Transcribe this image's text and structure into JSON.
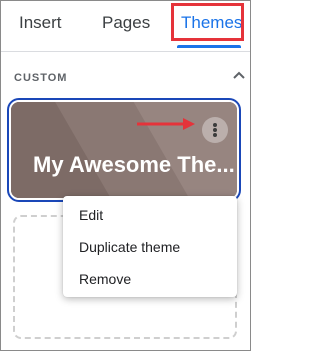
{
  "tabs": [
    {
      "label": "Insert"
    },
    {
      "label": "Pages"
    },
    {
      "label": "Themes"
    }
  ],
  "section": {
    "label": "CUSTOM",
    "collapse_icon": "chevron-up-icon"
  },
  "theme_card": {
    "title": "My Awesome The...",
    "more_icon": "more-vert-icon"
  },
  "context_menu": {
    "items": [
      "Edit",
      "Duplicate theme",
      "Remove"
    ]
  },
  "colors": {
    "accent": "#1a73e8",
    "highlight": "#e5333a",
    "selected_outline": "#1a47b8"
  }
}
